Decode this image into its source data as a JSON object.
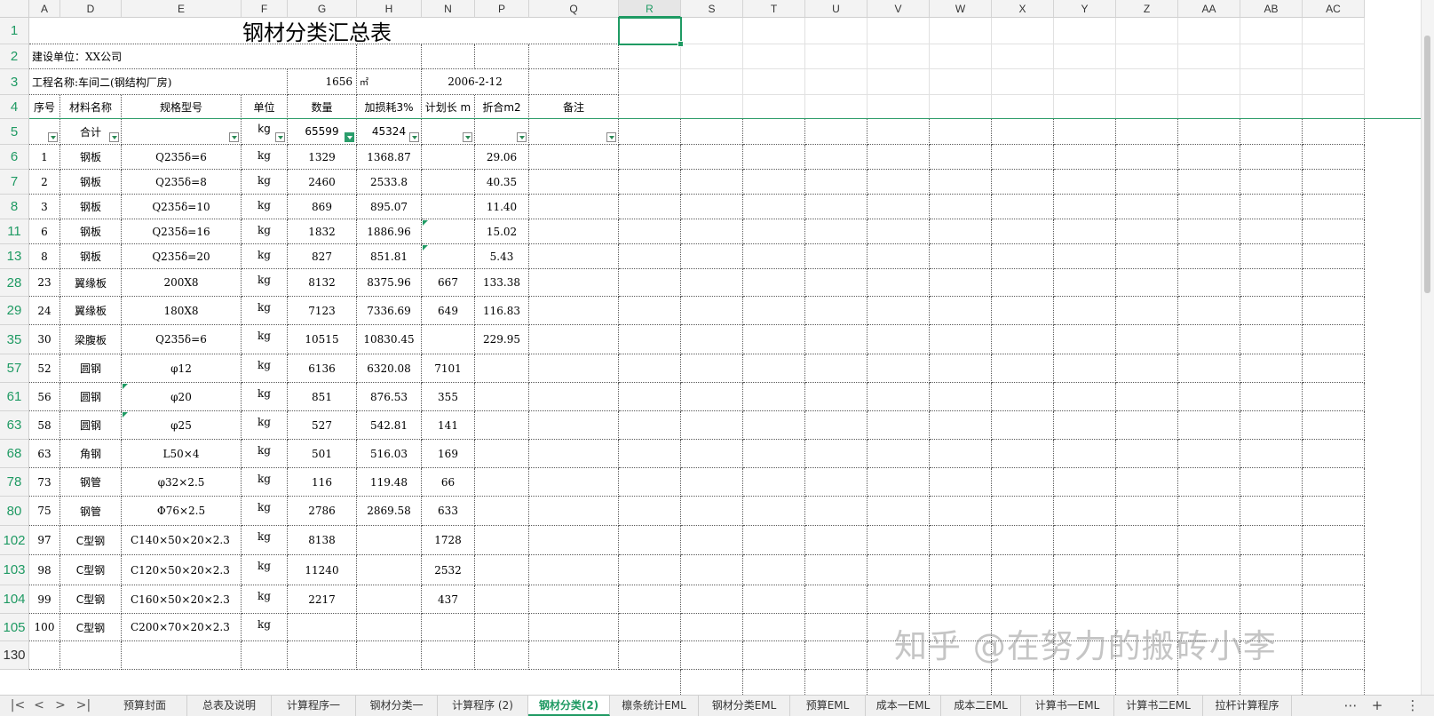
{
  "columns": [
    "A",
    "D",
    "E",
    "F",
    "G",
    "H",
    "N",
    "P",
    "Q",
    "R",
    "S",
    "T",
    "U",
    "V",
    "W",
    "X",
    "Y",
    "Z",
    "AA",
    "AB",
    "AC"
  ],
  "active_column": "R",
  "title": "钢材分类汇总表",
  "row2": {
    "label": "建设单位：XX公司"
  },
  "row3": {
    "label": "工程名称:车间二(钢结构厂房)",
    "area": "1656",
    "unit": "㎡",
    "date": "2006-2-12"
  },
  "headers": [
    "序号",
    "材料名称",
    "规格型号",
    "单位",
    "数量",
    "加损耗3%",
    "计划长 m",
    "折合m2",
    "备注"
  ],
  "total_row": {
    "name": "合计",
    "unit": "kg",
    "qty": "65599",
    "qty_loss": "45324"
  },
  "rows": [
    {
      "row": "6",
      "no": "1",
      "name": "钢板",
      "spec": "Q235δ=6",
      "unit": "kg",
      "qty": "1329",
      "loss": "1368.87",
      "len": "",
      "area": "29.06"
    },
    {
      "row": "7",
      "no": "2",
      "name": "钢板",
      "spec": "Q235δ=8",
      "unit": "kg",
      "qty": "2460",
      "loss": "2533.8",
      "len": "",
      "area": "40.35"
    },
    {
      "row": "8",
      "no": "3",
      "name": "钢板",
      "spec": "Q235δ=10",
      "unit": "kg",
      "qty": "869",
      "loss": "895.07",
      "len": "",
      "area": "11.40"
    },
    {
      "row": "11",
      "no": "6",
      "name": "钢板",
      "spec": "Q235δ=16",
      "unit": "kg",
      "qty": "1832",
      "loss": "1886.96",
      "len": "",
      "area": "15.02"
    },
    {
      "row": "13",
      "no": "8",
      "name": "钢板",
      "spec": "Q235δ=20",
      "unit": "kg",
      "qty": "827",
      "loss": "851.81",
      "len": "",
      "area": "5.43"
    },
    {
      "row": "28",
      "no": "23",
      "name": "翼缘板",
      "spec": "200X8",
      "unit": "kg",
      "qty": "8132",
      "loss": "8375.96",
      "len": "667",
      "area": "133.38"
    },
    {
      "row": "29",
      "no": "24",
      "name": "翼缘板",
      "spec": "180X8",
      "unit": "kg",
      "qty": "7123",
      "loss": "7336.69",
      "len": "649",
      "area": "116.83"
    },
    {
      "row": "35",
      "no": "30",
      "name": "梁腹板",
      "spec": "Q235δ=6",
      "unit": "kg",
      "qty": "10515",
      "loss": "10830.45",
      "len": "",
      "area": "229.95"
    },
    {
      "row": "57",
      "no": "52",
      "name": "圆钢",
      "spec": "φ12",
      "unit": "kg",
      "qty": "6136",
      "loss": "6320.08",
      "len": "7101",
      "area": ""
    },
    {
      "row": "61",
      "no": "56",
      "name": "圆钢",
      "spec": "φ20",
      "unit": "kg",
      "qty": "851",
      "loss": "876.53",
      "len": "355",
      "area": ""
    },
    {
      "row": "63",
      "no": "58",
      "name": "圆钢",
      "spec": "φ25",
      "unit": "kg",
      "qty": "527",
      "loss": "542.81",
      "len": "141",
      "area": ""
    },
    {
      "row": "68",
      "no": "63",
      "name": "角钢",
      "spec": "L50×4",
      "unit": "kg",
      "qty": "501",
      "loss": "516.03",
      "len": "169",
      "area": ""
    },
    {
      "row": "78",
      "no": "73",
      "name": "钢管",
      "spec": "φ32×2.5",
      "unit": "kg",
      "qty": "116",
      "loss": "119.48",
      "len": "66",
      "area": ""
    },
    {
      "row": "80",
      "no": "75",
      "name": "钢管",
      "spec": "Φ76×2.5",
      "unit": "kg",
      "qty": "2786",
      "loss": "2869.58",
      "len": "633",
      "area": ""
    },
    {
      "row": "102",
      "no": "97",
      "name": "C型钢",
      "spec": "C140×50×20×2.3",
      "unit": "kg",
      "qty": "8138",
      "loss": "",
      "len": "1728",
      "area": ""
    },
    {
      "row": "103",
      "no": "98",
      "name": "C型钢",
      "spec": "C120×50×20×2.3",
      "unit": "kg",
      "qty": "11240",
      "loss": "",
      "len": "2532",
      "area": ""
    },
    {
      "row": "104",
      "no": "99",
      "name": "C型钢",
      "spec": "C160×50×20×2.3",
      "unit": "kg",
      "qty": "2217",
      "loss": "",
      "len": "437",
      "area": ""
    },
    {
      "row": "105",
      "no": "100",
      "name": "C型钢",
      "spec": "C200×70×20×2.3",
      "unit": "kg",
      "qty": "",
      "loss": "",
      "len": "",
      "area": ""
    },
    {
      "row": "130",
      "no": "",
      "name": "",
      "spec": "",
      "unit": "",
      "qty": "",
      "loss": "",
      "len": "",
      "area": ""
    }
  ],
  "row_labels_top": [
    "1",
    "2",
    "3",
    "4",
    "5"
  ],
  "tabs": [
    "预算封面",
    "总表及说明",
    "计算程序一",
    "钢材分类一",
    "计算程序 (2)",
    "钢材分类(2)",
    "檩条统计EML",
    "钢材分类EML",
    "预算EML",
    "成本一EML",
    "成本二EML",
    "计算书一EML",
    "计算书二EML",
    "拉杆计算程序"
  ],
  "active_tab": "钢材分类(2)",
  "tab_nav": [
    "|<",
    "<",
    ">",
    ">|"
  ],
  "tab_tools": [
    "⋯",
    "+",
    "⋮"
  ],
  "watermark": "知乎 @在努力的搬砖小李",
  "colors": {
    "accent": "#1f9a63",
    "header_bg": "#f3f3f3"
  }
}
